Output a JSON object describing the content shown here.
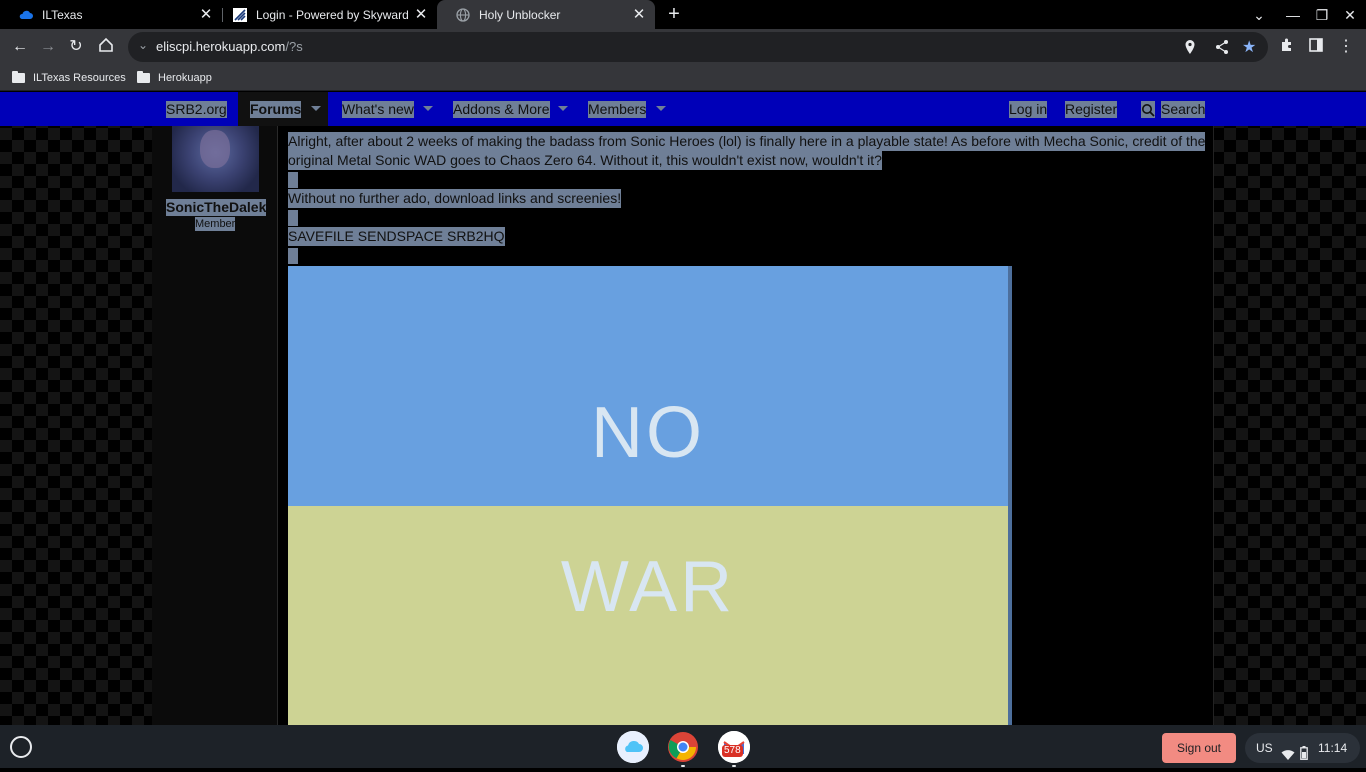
{
  "tabs": [
    {
      "title": "ILTexas",
      "active": false,
      "icon": "iltexas-cloud-icon"
    },
    {
      "title": "Login - Powered by Skyward",
      "active": false,
      "icon": "skyward-icon"
    },
    {
      "title": "Holy Unblocker",
      "active": true,
      "icon": "globe-icon"
    }
  ],
  "address_bar": {
    "host": "eliscpi.herokuapp.com",
    "path": "/?s"
  },
  "bookmarks": [
    "ILTexas Resources",
    "Herokuapp"
  ],
  "site_nav": {
    "left": [
      "SRB2.org",
      "Forums",
      "What's new",
      "Addons & More",
      "Members"
    ],
    "login": "Log in",
    "register": "Register",
    "search": "Search",
    "bar_color": "#0000b8"
  },
  "post": {
    "username": "SonicTheDalek",
    "role": "Member",
    "line1": "Alright, after about 2 weeks of making the badass from Sonic Heroes (lol) is finally here in a playable state! As before with Mecha Sonic, credit of the",
    "line2": "original Metal Sonic WAD goes to Chaos Zero 64. Without it, this wouldn't exist now, wouldn't it?",
    "line3": "Without no further ado, download links and screenies!",
    "links": "SAVEFILE SENDSPACE SRB2HQ",
    "banner_top": "NO",
    "banner_bottom": "WAR"
  },
  "shelf": {
    "sign_out": "Sign out",
    "locale": "US",
    "time": "11:14",
    "badge_count": "578"
  },
  "colors": {
    "selection": "#6f7f97",
    "banner_blue": "#68a0e0",
    "banner_yellow": "#cdd394",
    "sign_out_bg": "#f28b82"
  }
}
